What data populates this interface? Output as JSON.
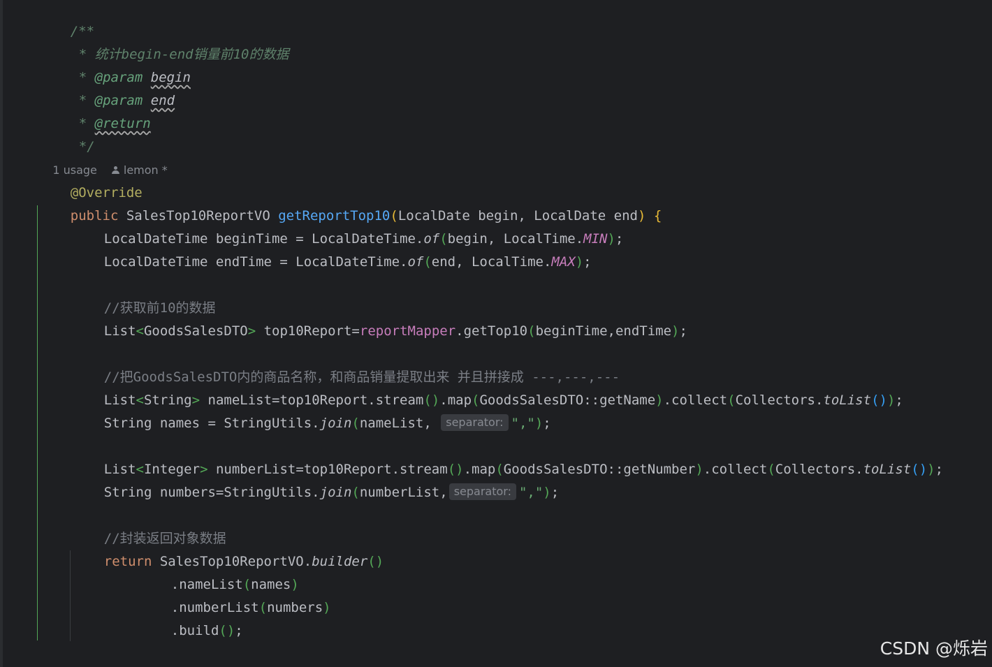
{
  "colors": {
    "background": "#1e1f22",
    "text": "#bcbec4",
    "keyword": "#cf8e6d",
    "method_declaration": "#56a8f5",
    "field": "#c77dbb",
    "string": "#6aab73",
    "comment": "#7a7e85",
    "doc_comment": "#5f826b",
    "annotation": "#b3ae60",
    "inlay_hint_bg": "#393b40"
  },
  "javadoc": {
    "open": "/**",
    "star": "*",
    "summary": "统计begin-end销量前10的数据",
    "param_tag": "@param",
    "param1": "begin",
    "param2": "end",
    "return_tag": "@return",
    "close": "*/"
  },
  "codelens": {
    "usage": "1 usage",
    "author": "lemon *"
  },
  "code": {
    "annotation": "@Override",
    "kw_public": "public",
    "ret_type": "SalesTop10ReportVO",
    "method_name": "getReportTop10",
    "params": "LocalDate begin, LocalDate end",
    "line_begin_pre": "LocalDateTime beginTime = LocalDateTime.",
    "of": "of",
    "line_begin_args": "begin, LocalTime.",
    "min": "MIN",
    "line_end_pre": "LocalDateTime endTime = LocalDateTime.",
    "line_end_args": "end, LocalTime.",
    "max": "MAX",
    "semi": ";",
    "comment_top10": "//获取前10的数据",
    "list_goods_pre": "List",
    "generic_goods": "GoodsSalesDTO",
    "list_goods_mid": " top10Report=",
    "report_mapper": "reportMapper",
    "get_top10": ".getTop10",
    "get_top10_args": "beginTime,endTime",
    "comment_names": "//把GoodsSalesDTO内的商品名称，和商品销量提取出来 并且拼接成 ---,---,---",
    "generic_string": "String",
    "namelist_mid": " nameList=top10Report.stream",
    "map": ".map",
    "map_name_arg": "GoodsSalesDTO::getName",
    "collect": ".collect",
    "collectors": "Collectors.",
    "to_list": "toList",
    "names_pre": "String names = StringUtils.",
    "join": "join",
    "namelist_arg": "nameList, ",
    "hint_separator": "separator:",
    "comma_str": "\",\"",
    "generic_integer": "Integer",
    "numberlist_mid": " numberList=top10Report.stream",
    "map_number_arg": "GoodsSalesDTO::getNumber",
    "numbers_pre": "String numbers=StringUtils.",
    "numberlist_arg": "numberList,",
    "comment_wrap": "//封装返回对象数据",
    "kw_return": "return",
    "builder_pre": " SalesTop10ReportVO.",
    "builder": "builder",
    "name_list_call": ".nameList",
    "names_arg": "names",
    "number_list_call": ".numberList",
    "numbers_arg": "numbers",
    "build_call": ".build",
    "close_brace": "}"
  },
  "watermark": "CSDN @烁岩"
}
